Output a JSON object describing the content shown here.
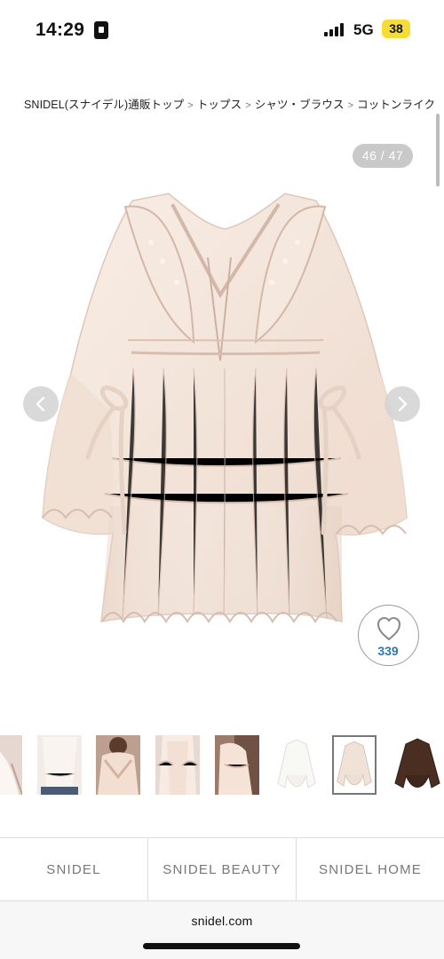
{
  "status_bar": {
    "time": "14:29",
    "network": "5G",
    "battery": "38"
  },
  "breadcrumb": {
    "items": [
      "SNIDEL(スナイデル)通販トップ",
      "トップス",
      "シャツ・ブラウス",
      "コットンライク"
    ],
    "separator": ">"
  },
  "gallery": {
    "counter": "46 / 47",
    "previous_icon": "chevron-left-icon",
    "next_icon": "chevron-right-icon"
  },
  "favorite": {
    "count": "339",
    "icon": "heart-icon"
  },
  "thumbnails": [
    {
      "name": "side-view",
      "selected": false
    },
    {
      "name": "back-view",
      "selected": false
    },
    {
      "name": "collar-detail",
      "selected": false
    },
    {
      "name": "model-view",
      "selected": false
    },
    {
      "name": "model-side",
      "selected": false
    },
    {
      "name": "white-color",
      "selected": false
    },
    {
      "name": "pink-color",
      "selected": true
    },
    {
      "name": "brown-color",
      "selected": false
    }
  ],
  "brand_tabs": [
    "SNIDEL",
    "SNIDEL BEAUTY",
    "SNIDEL HOME"
  ],
  "browser": {
    "url": "snidel.com"
  },
  "colors": {
    "accent": "#2b78ad",
    "product": "#f3e6dc",
    "battery": "#f6dc37"
  }
}
